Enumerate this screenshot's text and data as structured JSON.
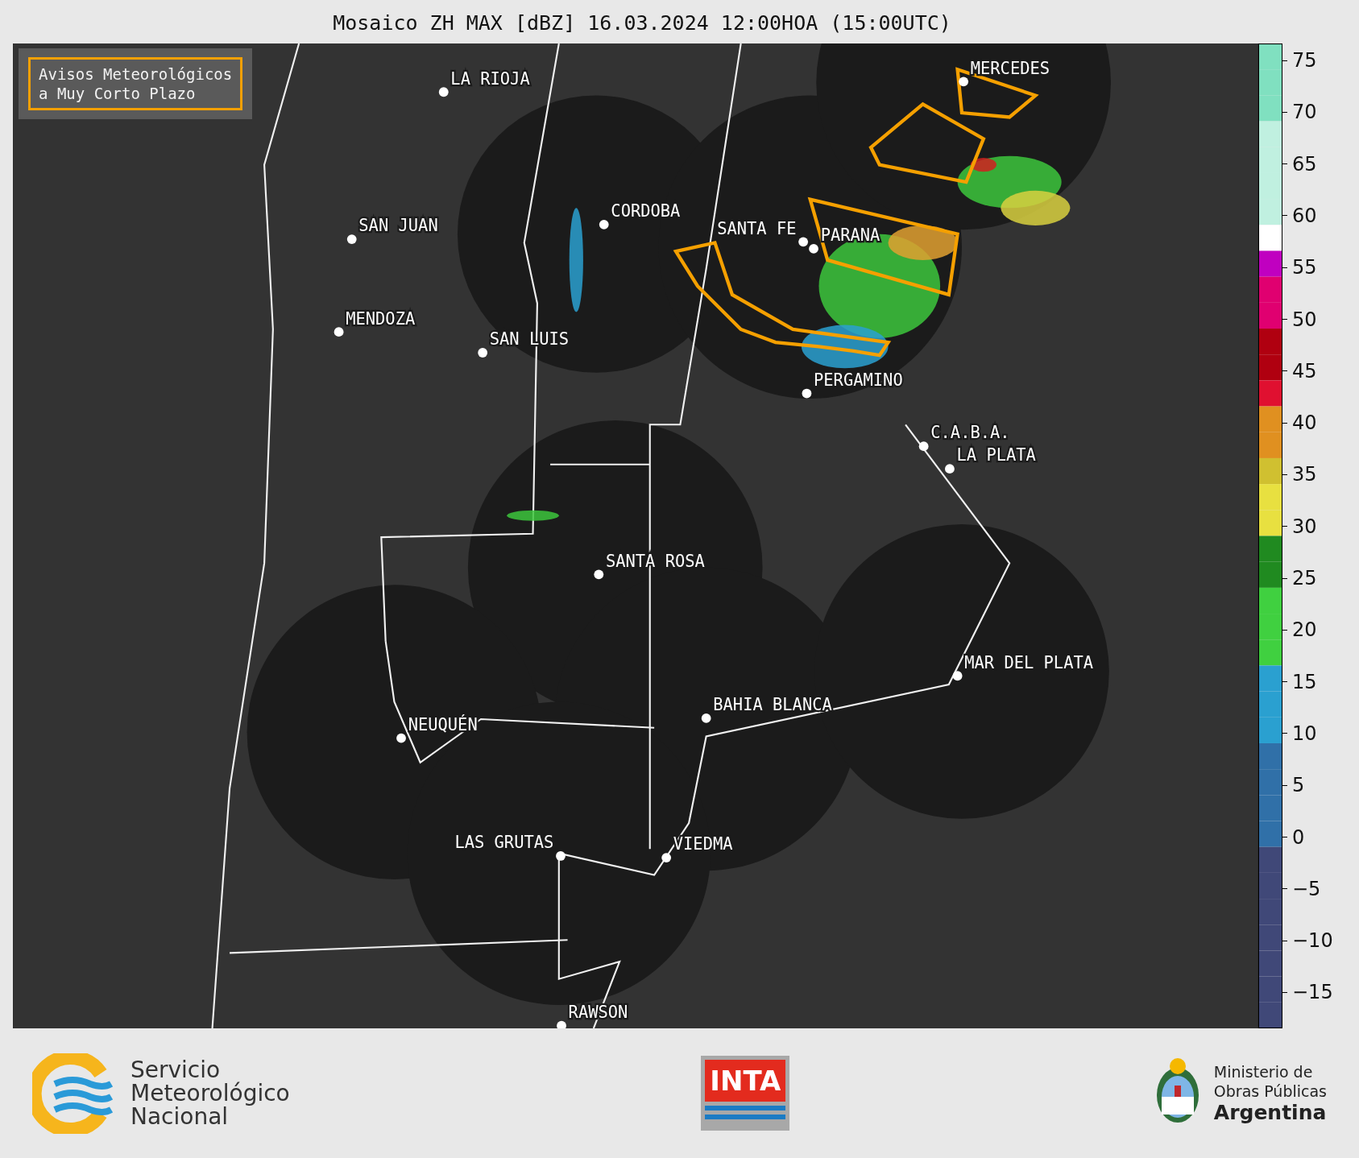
{
  "title": "Mosaico ZH MAX [dBZ] 16.03.2024 12:00HOA (15:00UTC)",
  "legend": {
    "text": "Avisos Meteorológicos\na Muy Corto Plazo"
  },
  "cities": [
    {
      "name": "MERCEDES"
    },
    {
      "name": "LA RIOJA"
    },
    {
      "name": "CORDOBA"
    },
    {
      "name": "SAN JUAN"
    },
    {
      "name": "SANTA FE"
    },
    {
      "name": "PARANA"
    },
    {
      "name": "MENDOZA"
    },
    {
      "name": "SAN LUIS"
    },
    {
      "name": "PERGAMINO"
    },
    {
      "name": "C.A.B.A."
    },
    {
      "name": "LA PLATA"
    },
    {
      "name": "SANTA ROSA"
    },
    {
      "name": "MAR DEL PLATA"
    },
    {
      "name": "BAHIA BLANCA"
    },
    {
      "name": "NEUQUÉN"
    },
    {
      "name": "LAS GRUTAS"
    },
    {
      "name": "VIEDMA"
    },
    {
      "name": "RAWSON"
    }
  ],
  "colorbar": {
    "ticks": [
      "75",
      "70",
      "65",
      "60",
      "55",
      "50",
      "45",
      "40",
      "35",
      "30",
      "25",
      "20",
      "15",
      "10",
      "5",
      "0",
      "−5",
      "−10",
      "−15"
    ]
  },
  "footer": {
    "smn": "Servicio\nMeteorológico\nNacional",
    "inta": "INTA",
    "ministry": "Ministerio de\nObras Públicas",
    "country": "Argentina"
  }
}
